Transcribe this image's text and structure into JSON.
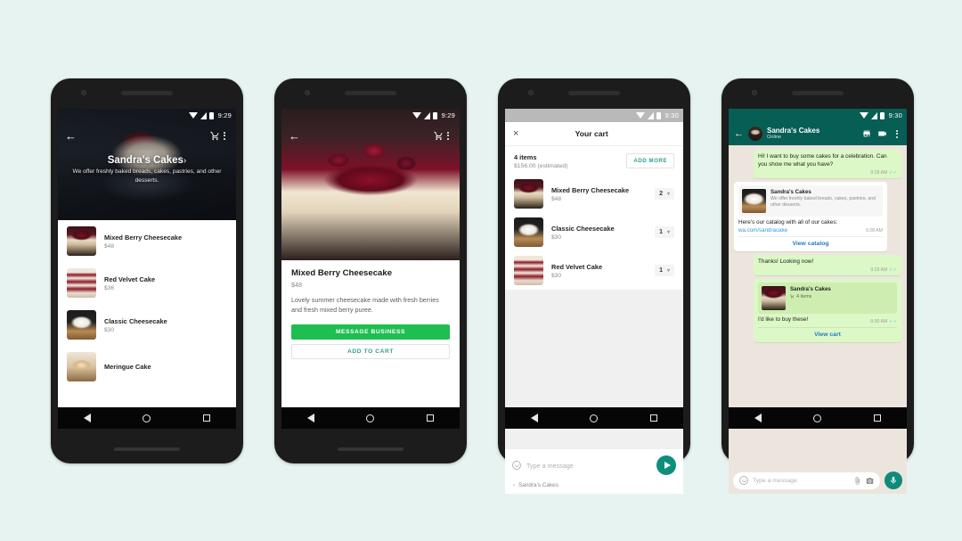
{
  "page": {
    "background": "#e7f3f0"
  },
  "phone1": {
    "status": {
      "time": "9:29"
    },
    "hero": {
      "title": "Sandra's Cakes",
      "chevron": "›",
      "subtitle": "We offer freshly baked breads, cakes, pastries, and other desserts."
    },
    "products": [
      {
        "name": "Mixed Berry Cheesecake",
        "price": "$48",
        "thumb": "cake-berry"
      },
      {
        "name": "Red Velvet Cake",
        "price": "$36",
        "thumb": "cake-velvet"
      },
      {
        "name": "Classic Cheesecake",
        "price": "$30",
        "thumb": "cake-classic"
      },
      {
        "name": "Meringue Cake",
        "price": "",
        "thumb": "cake-meringue"
      }
    ]
  },
  "phone2": {
    "status": {
      "time": "9:29"
    },
    "detail": {
      "title": "Mixed Berry Cheesecake",
      "price": "$48",
      "description": "Lovely summer cheesecake made with fresh berries and fresh mixed berry puree.",
      "primary_button": "MESSAGE BUSINESS",
      "secondary_button": "ADD TO CART"
    }
  },
  "phone3": {
    "status": {
      "time": "9:30"
    },
    "cart": {
      "title": "Your cart",
      "close_icon": "×",
      "items_count": "4 items",
      "estimated_total": "$156.00 (estimated)",
      "add_more_label": "ADD MORE",
      "items": [
        {
          "name": "Mixed Berry Cheesecake",
          "price": "$48",
          "qty": "2",
          "thumb": "cake-berry"
        },
        {
          "name": "Classic Cheesecake",
          "price": "$30",
          "qty": "1",
          "thumb": "cake-classic"
        },
        {
          "name": "Red Velvet Cake",
          "price": "$30",
          "qty": "1",
          "thumb": "cake-velvet"
        }
      ],
      "message_placeholder": "Type a message",
      "business_name": "Sandra's Cakes"
    }
  },
  "phone4": {
    "status": {
      "time": "9:30"
    },
    "chat": {
      "contact_name": "Sandra's Cakes",
      "presence": "Online",
      "messages": [
        {
          "kind": "text",
          "side": "out",
          "text": "Hi! I want to buy some cakes for a celebration. Can you show me what you have?",
          "time": "9:28 AM"
        },
        {
          "kind": "catalog",
          "side": "in",
          "card_title": "Sandra's Cakes",
          "card_desc": "We offer freshly baked breads, cakes, pastries, and other desserts.",
          "text": "Here's our catalog with all of our cakes:",
          "link": "wa.com/sandracake",
          "time": "9:28 AM",
          "cta": "View catalog"
        },
        {
          "kind": "text",
          "side": "out",
          "text": "Thanks! Looking now!",
          "time": "9:29 AM"
        },
        {
          "kind": "cart",
          "side": "out",
          "card_title": "Sandra's Cakes",
          "card_items": "4 items",
          "text": "I'd like to buy these!",
          "time": "9:30 AM",
          "cta": "View cart"
        }
      ],
      "input_placeholder": "Type a message"
    }
  },
  "icons": {
    "back": "←",
    "chevron_right": "›",
    "chevron_down": "⌄",
    "tick": "✓✓"
  }
}
